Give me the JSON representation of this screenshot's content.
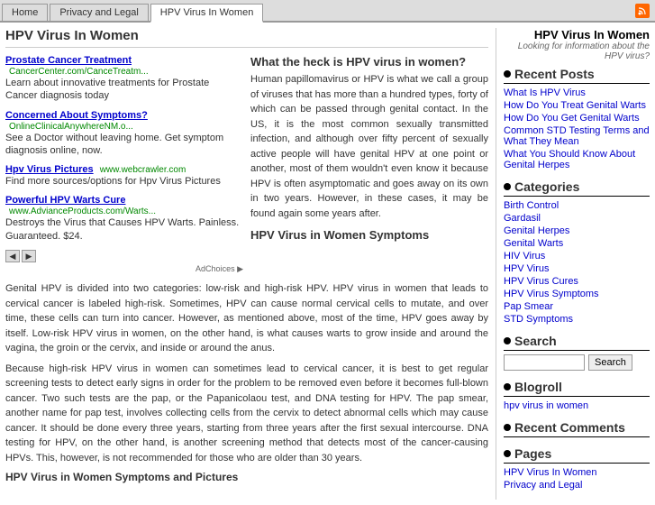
{
  "tabs": [
    {
      "label": "Home",
      "active": false
    },
    {
      "label": "Privacy and Legal",
      "active": false
    },
    {
      "label": "HPV Virus In Women",
      "active": true
    }
  ],
  "sidebar": {
    "title": "HPV Virus In Women",
    "subtitle": "Looking for information about the HPV virus?",
    "recent_posts_title": "Recent Posts",
    "recent_posts": [
      "What Is HPV Virus",
      "How Do You Treat Genital Warts",
      "How Do You Get Genital Warts",
      "Common STD Testing Terms and What They Mean",
      "What You Should Know About Genital Herpes"
    ],
    "categories_title": "Categories",
    "categories": [
      "Birth Control",
      "Gardasil",
      "Genital Herpes",
      "Genital Warts",
      "HIV Virus",
      "HPV Virus",
      "HPV Virus Cures",
      "HPV Virus Symptoms",
      "Pap Smear",
      "STD Symptoms"
    ],
    "search_title": "Search",
    "search_placeholder": "",
    "search_button": "Search",
    "blogroll_title": "Blogroll",
    "blogroll_links": [
      "hpv virus in women"
    ],
    "recent_comments_title": "Recent Comments",
    "pages_title": "Pages",
    "pages": [
      "HPV Virus In Women",
      "Privacy and Legal"
    ]
  },
  "main": {
    "title": "HPV Virus In Women",
    "ads": [
      {
        "title": "Prostate Cancer Treatment",
        "url": "CancerCenter.com/CanceTreatm...",
        "desc": "Learn about innovative treatments for Prostate Cancer diagnosis today"
      },
      {
        "title": "Concerned About Symptoms?",
        "url": "OnlineClinicalAnywhereNM.o...",
        "desc": "See a Doctor without leaving home. Get symptom diagnosis online, now."
      },
      {
        "title": "Hpv Virus Pictures",
        "url": "www.webcrawler.com",
        "desc": "Find more sources/options for Hpv Virus Pictures"
      },
      {
        "title": "Powerful HPV Warts Cure",
        "url": "www.AdvianceProducts.com/Warts...",
        "desc": "Destroys the Virus that Causes HPV Warts. Painless. Guaranteed. $24."
      }
    ],
    "ad_choices": "AdChoices ▶",
    "article_title": "What the heck is HPV virus in women?",
    "article_text": "Human papillomavirus or HPV is what we call a group of viruses that has more than a hundred types, forty of which can be passed through genital contact. In the US, it is the most common sexually transmitted infection, and although over fifty percent of sexually active people will have genital HPV at one point or another, most of them wouldn't even know it because HPV is often asymptomatic and goes away on its own in two years. However, in these cases, it may be found again some years after.",
    "symptoms_title": "HPV Virus in Women Symptoms",
    "body1": "Genital HPV is divided into two categories: low-risk and high-risk HPV. HPV virus in women that leads to cervical cancer is labeled high-risk. Sometimes, HPV can cause normal cervical cells to mutate, and over time, these cells can turn into cancer. However, as mentioned above, most of the time, HPV goes away by itself. Low-risk HPV virus in women, on the other hand, is what causes warts to grow inside and around the vagina, the groin or the cervix, and inside or around the anus.",
    "body2": "Because high-risk HPV virus in women can sometimes lead to cervical cancer, it is best to get regular screening tests to detect early signs in order for the problem to be removed even before it becomes full-blown cancer. Two such tests are the pap, or the Papanicolaou test, and DNA testing for HPV. The pap smear, another name for pap test, involves collecting cells from the cervix to detect abnormal cells which may cause cancer. It should be done every three years, starting from three years after the first sexual intercourse. DNA testing for HPV, on the other hand, is another screening method that detects most of the cancer-causing HPVs. This, however, is not recommended for those who are older than 30 years.",
    "bottom_title": "HPV Virus in Women Symptoms and Pictures"
  }
}
